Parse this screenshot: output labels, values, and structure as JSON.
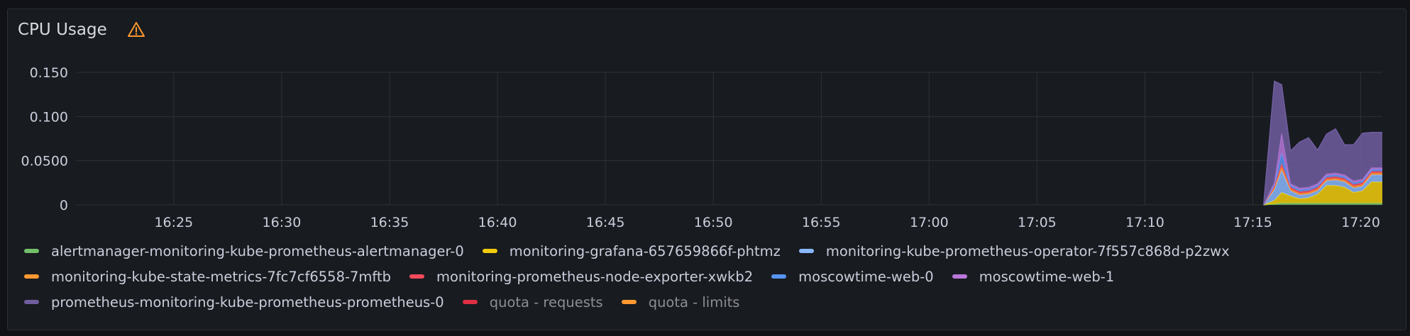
{
  "panel": {
    "title": "CPU Usage",
    "warning_icon": "warning-triangle-icon",
    "warning_color": "#ff9830"
  },
  "chart_data": {
    "type": "area",
    "stacked": true,
    "x_ticks": [
      "16:25",
      "16:30",
      "16:35",
      "16:40",
      "16:45",
      "16:50",
      "16:55",
      "17:00",
      "17:05",
      "17:10",
      "17:15",
      "17:20"
    ],
    "y_ticks": [
      "0",
      "0.0500",
      "0.100",
      "0.150"
    ],
    "ylim": [
      0,
      0.15
    ],
    "xlim": [
      "16:20:30",
      "17:21:00"
    ],
    "grid": true,
    "legend_placement": "bottom",
    "x": [
      "17:15:30",
      "17:16:00",
      "17:16:20",
      "17:16:45",
      "17:17:10",
      "17:17:35",
      "17:18:00",
      "17:18:25",
      "17:18:50",
      "17:19:15",
      "17:19:40",
      "17:20:05",
      "17:20:30",
      "17:21:00"
    ],
    "series": [
      {
        "name": "alertmanager-monitoring-kube-prometheus-alertmanager-0",
        "color": "#73bf69",
        "values": [
          0,
          0.001,
          0.002,
          0.002,
          0.002,
          0.002,
          0.002,
          0.002,
          0.002,
          0.002,
          0.002,
          0.002,
          0.002,
          0.002
        ]
      },
      {
        "name": "monitoring-grafana-657659866f-phtmz",
        "color": "#f2cc0c",
        "values": [
          0,
          0.004,
          0.012,
          0.008,
          0.005,
          0.006,
          0.01,
          0.02,
          0.02,
          0.018,
          0.012,
          0.014,
          0.024,
          0.024
        ]
      },
      {
        "name": "monitoring-kube-prometheus-operator-7f557c868d-p2zwx",
        "color": "#8ab8ff",
        "values": [
          0,
          0.012,
          0.025,
          0.006,
          0.004,
          0.004,
          0.004,
          0.005,
          0.006,
          0.006,
          0.005,
          0.005,
          0.008,
          0.008
        ]
      },
      {
        "name": "monitoring-kube-state-metrics-7fc7cf6558-7mftb",
        "color": "#ff9830",
        "values": [
          0,
          0.002,
          0.004,
          0.002,
          0.002,
          0.002,
          0.002,
          0.002,
          0.002,
          0.002,
          0.002,
          0.002,
          0.002,
          0.002
        ]
      },
      {
        "name": "monitoring-prometheus-node-exporter-xwkb2",
        "color": "#f2495c",
        "values": [
          0,
          0.002,
          0.004,
          0.002,
          0.002,
          0.002,
          0.002,
          0.002,
          0.002,
          0.002,
          0.002,
          0.002,
          0.002,
          0.002
        ]
      },
      {
        "name": "moscowtime-web-0",
        "color": "#5794f2",
        "values": [
          0,
          0.002,
          0.012,
          0.002,
          0.002,
          0.002,
          0.002,
          0.002,
          0.002,
          0.002,
          0.002,
          0.002,
          0.002,
          0.002
        ]
      },
      {
        "name": "moscowtime-web-1",
        "color": "#b877d9",
        "values": [
          0,
          0.002,
          0.022,
          0.002,
          0.002,
          0.002,
          0.002,
          0.002,
          0.002,
          0.002,
          0.002,
          0.002,
          0.002,
          0.002
        ]
      },
      {
        "name": "prometheus-monitoring-kube-prometheus-prometheus-0",
        "color": "#705da0",
        "values": [
          0,
          0.115,
          0.055,
          0.037,
          0.052,
          0.056,
          0.038,
          0.045,
          0.05,
          0.034,
          0.041,
          0.052,
          0.04,
          0.04
        ]
      },
      {
        "name": "quota - requests",
        "color": "#e02f44",
        "values": [],
        "muted": true
      },
      {
        "name": "quota - limits",
        "color": "#ff9830",
        "values": [],
        "muted": true
      }
    ]
  }
}
